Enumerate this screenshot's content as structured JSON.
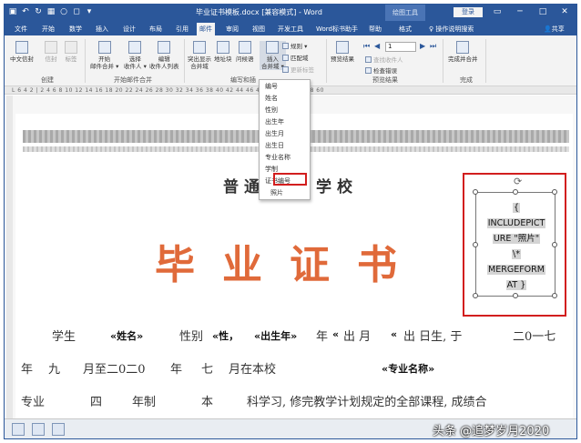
{
  "app": {
    "title": "毕业证书模板.docx [兼容模式] - Word",
    "context_tools": "绘图工具",
    "signin": "登录",
    "colors": {
      "brand": "#2b579a",
      "highlight_box": "#d21e1e",
      "cert_title": "#e06a3a"
    }
  },
  "qat": {
    "icons": [
      "save-icon",
      "undo-icon",
      "redo-icon",
      "table-icon",
      "circle-icon",
      "shape-icon"
    ]
  },
  "window_controls": [
    "ribbon-display-icon",
    "minimize-icon",
    "maximize-icon",
    "close-icon"
  ],
  "tabs": [
    "文件",
    "开始",
    "数学",
    "插入",
    "设计",
    "布局",
    "引用",
    "邮件",
    "审阅",
    "视图",
    "开发工具",
    "Word标书助手",
    "帮助",
    "格式"
  ],
  "active_tab": "邮件",
  "search_label": "操作说明搜索",
  "share_label": "共享",
  "ribbon": {
    "create": {
      "label": "创建",
      "buttons": [
        "中文信封",
        "信封",
        "标签"
      ]
    },
    "start_merge": {
      "label": "开始邮件合并",
      "buttons": [
        "开始\n邮件合并 ▾",
        "选择\n收件人 ▾",
        "编辑\n收件人列表"
      ]
    },
    "write_insert": {
      "label": "编写和插",
      "buttons": [
        "突出显示\n合并域",
        "地址块",
        "问候语",
        "插入\n合并域 ▾"
      ],
      "small": [
        "规则 ▾",
        "匹配域",
        "更新标签"
      ]
    },
    "preview": {
      "label": "预览结果",
      "button": "预览结果",
      "record": "1",
      "small": [
        "查找收件人",
        "检查错误"
      ]
    },
    "finish": {
      "label": "完成",
      "button": "完成并合并"
    }
  },
  "ruler_text": "L 6 4 2 | 2 4 6 8 10 12 14 16 18 20 22 24 26 28 30 32 34 36 38 40 42 44 46 48 50 52 54 56 58 60",
  "dropdown": {
    "items": [
      "编号",
      "姓名",
      "性别",
      "出生年",
      "出生月",
      "出生日",
      "专业名称",
      "学制",
      "证书编号",
      "照片"
    ],
    "highlighted": "照片"
  },
  "document": {
    "school_left": "普通",
    "school_right": "学校",
    "cert_title": "毕业证书",
    "line1": {
      "student": "学生",
      "name_field": "«姓名»",
      "gender_label": "性别",
      "gender_field": "«性，",
      "birthyear_field": "«出生年»",
      "year": "年",
      "open1": "«",
      "out_month": "出 月",
      "open2": "«",
      "out_day": "出 日生, 于",
      "year_2017": "二0一七"
    },
    "line2": {
      "year": "年",
      "nine": "九",
      "month_to": "月至二0二0",
      "year2": "年",
      "seven": "七",
      "month_in": "月在本校",
      "major_field": "«专业名称»"
    },
    "line3": {
      "major": "专业",
      "four": "四",
      "system": "年制",
      "ben": "本",
      "rest": "科学习, 修完教学计划规定的全部课程, 成绩合"
    }
  },
  "field_code": {
    "lines": [
      "{",
      "INCLUDEPICT",
      "URE \"照片\"",
      "\\*",
      "MERGEFORM",
      "AT }"
    ]
  },
  "watermark": "头条 @追梦岁月2020"
}
